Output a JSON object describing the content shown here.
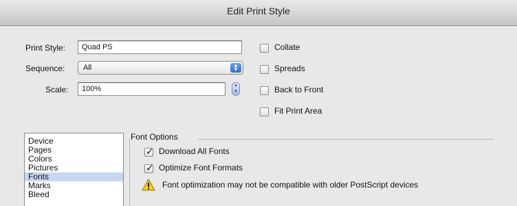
{
  "window": {
    "title": "Edit Print Style"
  },
  "form": {
    "print_style_label": "Print Style:",
    "print_style_value": "Quad PS",
    "sequence_label": "Sequence:",
    "sequence_value": "All",
    "scale_label": "Scale:",
    "scale_value": "100%"
  },
  "options": {
    "collate": {
      "label": "Collate",
      "checked": false
    },
    "spreads": {
      "label": "Spreads",
      "checked": false
    },
    "back_to_front": {
      "label": "Back to Front",
      "checked": false
    },
    "fit_print_area": {
      "label": "Fit Print Area",
      "checked": false
    }
  },
  "category_list": {
    "items": [
      "Device",
      "Pages",
      "Colors",
      "Pictures",
      "Fonts",
      "Marks",
      "Bleed"
    ],
    "selected": "Fonts"
  },
  "font_options": {
    "group_title": "Font Options",
    "download_all_fonts": {
      "label": "Download All Fonts",
      "checked": true
    },
    "optimize_font_formats": {
      "label": "Optimize Font Formats",
      "checked": true
    },
    "warning_text": "Font optimization may not be compatible with older PostScript devices"
  },
  "icons": {
    "popup": "updown-arrows-icon",
    "stepper": "stepper-icon",
    "warning": "warning-icon"
  },
  "colors": {
    "selection": "#c7d7f0",
    "popup_accent": "#2f6bd1",
    "warning_yellow": "#f5d10a"
  }
}
